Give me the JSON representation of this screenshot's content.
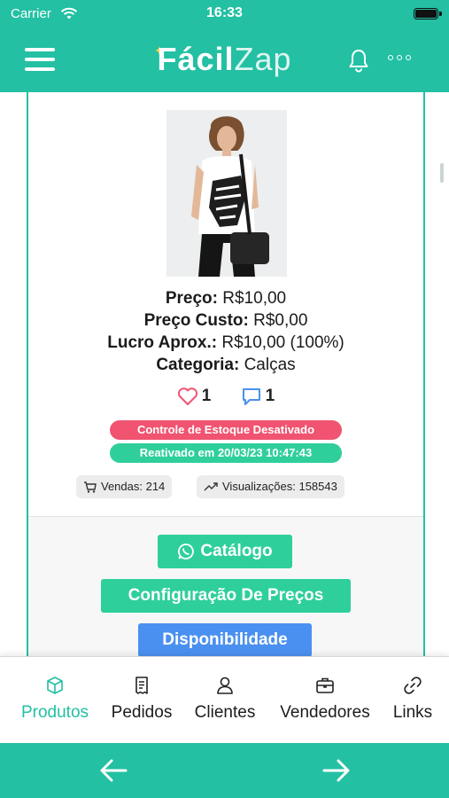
{
  "status": {
    "carrier": "Carrier",
    "time": "16:33"
  },
  "header": {
    "logo_bold": "Fácil",
    "logo_light": "Zap"
  },
  "product": {
    "price_label": "Preço:",
    "price_value": "R$10,00",
    "cost_label": "Preço Custo:",
    "cost_value": "R$0,00",
    "profit_label": "Lucro Aprox.:",
    "profit_value": "R$10,00 (100%)",
    "category_label": "Categoria:",
    "category_value": "Calças",
    "likes": "1",
    "comments": "1"
  },
  "badges": {
    "stock": "Controle de Estoque Desativado",
    "reactivated": "Reativado em 20/03/23 10:47:43"
  },
  "stats": {
    "sales": "Vendas: 214",
    "views": "Visualizações: 158543"
  },
  "actions": {
    "catalog": "Catálogo",
    "price_config": "Configuração De Preços",
    "availability": "Disponibilidade"
  },
  "tabs": [
    {
      "label": "Produtos",
      "icon": "box-icon",
      "active": true
    },
    {
      "label": "Pedidos",
      "icon": "document-icon"
    },
    {
      "label": "Clientes",
      "icon": "user-icon"
    },
    {
      "label": "Vendedores",
      "icon": "briefcase-icon"
    },
    {
      "label": "Links",
      "icon": "link-icon"
    }
  ],
  "colors": {
    "brand": "#23c0a3",
    "badge_red": "#f05470",
    "badge_green": "#2fcf9b",
    "blue": "#4a90f0"
  }
}
